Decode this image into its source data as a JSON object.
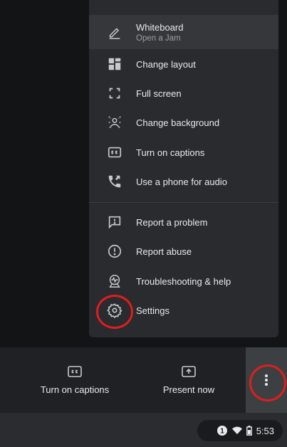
{
  "menu": {
    "items": [
      {
        "label": "Whiteboard",
        "sub": "Open a Jam",
        "icon": "pencil-icon"
      },
      {
        "label": "Change layout",
        "icon": "layout-icon"
      },
      {
        "label": "Full screen",
        "icon": "fullscreen-icon"
      },
      {
        "label": "Change background",
        "icon": "background-icon"
      },
      {
        "label": "Turn on captions",
        "icon": "captions-icon"
      },
      {
        "label": "Use a phone for audio",
        "icon": "phone-audio-icon"
      },
      {
        "label": "Report a problem",
        "icon": "report-problem-icon"
      },
      {
        "label": "Report abuse",
        "icon": "report-abuse-icon"
      },
      {
        "label": "Troubleshooting & help",
        "icon": "troubleshooting-icon"
      },
      {
        "label": "Settings",
        "icon": "gear-icon"
      }
    ]
  },
  "toolbar": {
    "captions_label": "Turn on captions",
    "present_label": "Present now"
  },
  "status": {
    "notification_count": "1",
    "time": "5:53"
  },
  "colors": {
    "highlight_circle": "#e11d1d",
    "menu_bg": "#2a2b2e",
    "text": "#e8eaed"
  }
}
